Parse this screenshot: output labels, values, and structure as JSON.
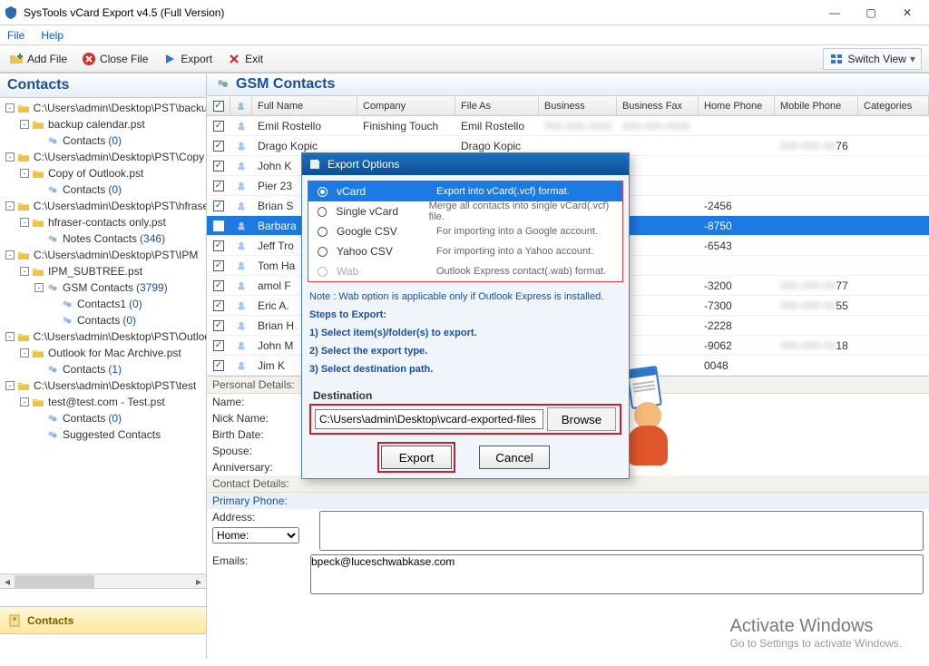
{
  "window": {
    "title": "SysTools vCard Export v4.5 (Full Version)"
  },
  "menu": {
    "file": "File",
    "help": "Help"
  },
  "toolbar": {
    "addfile": "Add File",
    "closefile": "Close File",
    "export": "Export",
    "exit": "Exit",
    "switchview": "Switch View"
  },
  "sidebar": {
    "title": "Contacts",
    "nodes": [
      {
        "ind": 0,
        "exp": "-",
        "icon": "pst",
        "label": "C:\\Users\\admin\\Desktop\\PST\\backup"
      },
      {
        "ind": 1,
        "exp": "-",
        "icon": "fold",
        "label": "backup calendar.pst"
      },
      {
        "ind": 2,
        "exp": "",
        "icon": "cont",
        "label": "Contacts",
        "count": "(0)"
      },
      {
        "ind": 0,
        "exp": "-",
        "icon": "pst",
        "label": "C:\\Users\\admin\\Desktop\\PST\\Copy"
      },
      {
        "ind": 1,
        "exp": "-",
        "icon": "fold",
        "label": "Copy of Outlook.pst"
      },
      {
        "ind": 2,
        "exp": "",
        "icon": "cont",
        "label": "Contacts",
        "count": "(0)"
      },
      {
        "ind": 0,
        "exp": "-",
        "icon": "pst",
        "label": "C:\\Users\\admin\\Desktop\\PST\\hfraser"
      },
      {
        "ind": 1,
        "exp": "-",
        "icon": "fold",
        "label": "hfraser-contacts only.pst"
      },
      {
        "ind": 2,
        "exp": "",
        "icon": "cont",
        "label": "Notes Contacts",
        "count": "(346)"
      },
      {
        "ind": 0,
        "exp": "-",
        "icon": "pst",
        "label": "C:\\Users\\admin\\Desktop\\PST\\IPM"
      },
      {
        "ind": 1,
        "exp": "-",
        "icon": "fold",
        "label": "IPM_SUBTREE.pst"
      },
      {
        "ind": 2,
        "exp": "-",
        "icon": "cont",
        "label": "GSM Contacts",
        "count": "(3799)"
      },
      {
        "ind": 3,
        "exp": "",
        "icon": "cont",
        "label": "Contacts1",
        "count": "(0)"
      },
      {
        "ind": 3,
        "exp": "",
        "icon": "cont",
        "label": "Contacts",
        "count": "(0)"
      },
      {
        "ind": 0,
        "exp": "-",
        "icon": "pst",
        "label": "C:\\Users\\admin\\Desktop\\PST\\Outlook"
      },
      {
        "ind": 1,
        "exp": "-",
        "icon": "fold",
        "label": "Outlook for Mac Archive.pst"
      },
      {
        "ind": 2,
        "exp": "",
        "icon": "cont",
        "label": "Contacts",
        "count": "(1)"
      },
      {
        "ind": 0,
        "exp": "-",
        "icon": "pst",
        "label": "C:\\Users\\admin\\Desktop\\PST\\test"
      },
      {
        "ind": 1,
        "exp": "-",
        "icon": "fold",
        "label": "test@test.com - Test.pst"
      },
      {
        "ind": 2,
        "exp": "",
        "icon": "cont",
        "label": "Contacts",
        "count": "(0)"
      },
      {
        "ind": 2,
        "exp": "",
        "icon": "cont",
        "label": "Suggested Contacts"
      }
    ],
    "footer": "Contacts"
  },
  "grid_title": "GSM Contacts",
  "grid_cols": [
    "Full Name",
    "Company",
    "File As",
    "Business",
    "Business Fax",
    "Home Phone",
    "Mobile Phone",
    "Categories"
  ],
  "rows": [
    {
      "name": "Emil Rostello",
      "company": "Finishing Touch",
      "fileas": "Emil Rostello",
      "bus": "blur",
      "busfax": "blur"
    },
    {
      "name": "Drago Kopic",
      "company": "",
      "fileas": "Drago Kopic",
      "mobile_suffix": "76"
    },
    {
      "name": "John K"
    },
    {
      "name": "Pier 23"
    },
    {
      "name": "Brian S",
      "home": "-2456"
    },
    {
      "name": "Barbara",
      "home": "-8750",
      "sel": true
    },
    {
      "name": "Jeff Tro",
      "home": "-6543"
    },
    {
      "name": "Tom Ha"
    },
    {
      "name": "amol F",
      "home": "-3200",
      "mobile_suffix": "77"
    },
    {
      "name": "Eric A.",
      "home": "-7300",
      "mobile_suffix": "55"
    },
    {
      "name": "Brian H",
      "home": "-2228"
    },
    {
      "name": "John M",
      "home": "-9062",
      "mobile_suffix": "18"
    },
    {
      "name": "Jim K",
      "home": "0048"
    }
  ],
  "details": {
    "personal_head": "Personal Details:",
    "name": "Name:",
    "nick": "Nick Name:",
    "birth": "Birth Date:",
    "spouse": "Spouse:",
    "anniv": "Anniversary:",
    "contact_head": "Contact Details:",
    "primary": "Primary Phone:",
    "address": "Address:",
    "home_select": "Home:",
    "emails": "Emails:",
    "email_val": "bpeck@luceschwabkase.com"
  },
  "dialog": {
    "title": "Export Options",
    "options": [
      {
        "name": "vCard",
        "desc": "Export into vCard(.vcf) format.",
        "sel": true
      },
      {
        "name": "Single vCard",
        "desc": "Merge all contacts into single vCard(.vcf) file."
      },
      {
        "name": "Google CSV",
        "desc": "For importing into a Google account."
      },
      {
        "name": "Yahoo CSV",
        "desc": "For importing into a Yahoo account."
      },
      {
        "name": "Wab",
        "desc": "Outlook Express contact(.wab) format.",
        "disabled": true
      }
    ],
    "note": "Note : Wab option is applicable only if Outlook Express is installed.",
    "steps_head": "Steps to Export:",
    "step1": "1) Select item(s)/folder(s) to export.",
    "step2": "2) Select the export type.",
    "step3": "3) Select destination path.",
    "dest_label": "Destination",
    "dest_value": "C:\\Users\\admin\\Desktop\\vcard-exported-files",
    "browse": "Browse",
    "export": "Export",
    "cancel": "Cancel"
  },
  "activate": {
    "big": "Activate Windows",
    "small": "Go to Settings to activate Windows."
  }
}
